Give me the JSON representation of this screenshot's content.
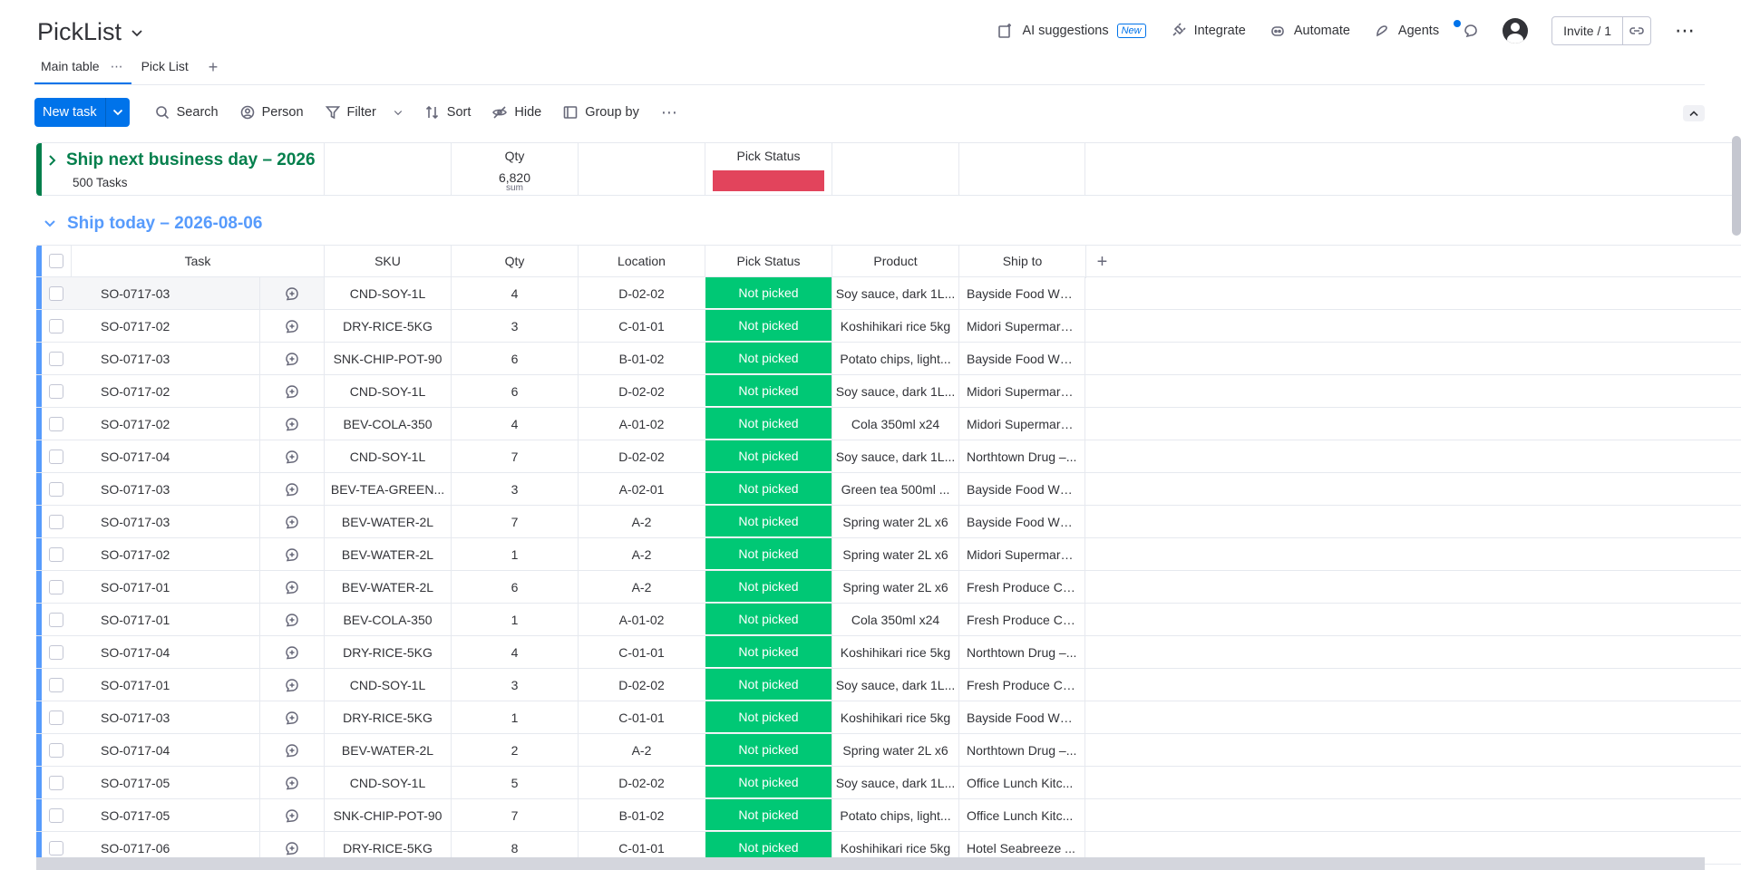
{
  "board": {
    "title": "PickList"
  },
  "top_actions": {
    "ai_suggestions": "AI suggestions",
    "ai_badge": "New",
    "integrate": "Integrate",
    "automate": "Automate",
    "agents": "Agents",
    "invite": "Invite / 1"
  },
  "tabs": [
    {
      "label": "Main table",
      "active": true
    },
    {
      "label": "Pick List",
      "active": false
    }
  ],
  "toolbar": {
    "new_task": "New task",
    "search": "Search",
    "person": "Person",
    "filter": "Filter",
    "sort": "Sort",
    "hide": "Hide",
    "group_by": "Group by"
  },
  "collapsed_group": {
    "name": "Ship next business day – 2026",
    "count": "500 Tasks",
    "qty_header": "Qty",
    "qty_value": "6,820",
    "qty_caption": "sum",
    "status_header": "Pick Status",
    "status_color": "#e2445c",
    "color": "#037f4c"
  },
  "group": {
    "name": "Ship today – 2026-08-06",
    "color": "#579bfc"
  },
  "columns": {
    "task": "Task",
    "sku": "SKU",
    "qty": "Qty",
    "location": "Location",
    "status": "Pick Status",
    "product": "Product",
    "ship_to": "Ship to"
  },
  "status_colors": {
    "Not picked": "#00c875"
  },
  "rows": [
    {
      "task": "SO-0717-03",
      "sku": "CND-SOY-1L",
      "qty": "4",
      "location": "D-02-02",
      "status": "Not picked",
      "product": "Soy sauce, dark 1L...",
      "ship_to": "Bayside Food Wh..."
    },
    {
      "task": "SO-0717-02",
      "sku": "DRY-RICE-5KG",
      "qty": "3",
      "location": "C-01-01",
      "status": "Not picked",
      "product": "Koshihikari rice 5kg",
      "ship_to": "Midori Supermark..."
    },
    {
      "task": "SO-0717-03",
      "sku": "SNK-CHIP-POT-90",
      "qty": "6",
      "location": "B-01-02",
      "status": "Not picked",
      "product": "Potato chips, light...",
      "ship_to": "Bayside Food Wh..."
    },
    {
      "task": "SO-0717-02",
      "sku": "CND-SOY-1L",
      "qty": "6",
      "location": "D-02-02",
      "status": "Not picked",
      "product": "Soy sauce, dark 1L...",
      "ship_to": "Midori Supermark..."
    },
    {
      "task": "SO-0717-02",
      "sku": "BEV-COLA-350",
      "qty": "4",
      "location": "A-01-02",
      "status": "Not picked",
      "product": "Cola 350ml x24",
      "ship_to": "Midori Supermark..."
    },
    {
      "task": "SO-0717-04",
      "sku": "CND-SOY-1L",
      "qty": "7",
      "location": "D-02-02",
      "status": "Not picked",
      "product": "Soy sauce, dark 1L...",
      "ship_to": "Northtown Drug –..."
    },
    {
      "task": "SO-0717-03",
      "sku": "BEV-TEA-GREEN...",
      "qty": "3",
      "location": "A-02-01",
      "status": "Not picked",
      "product": "Green tea 500ml ...",
      "ship_to": "Bayside Food Wh..."
    },
    {
      "task": "SO-0717-03",
      "sku": "BEV-WATER-2L",
      "qty": "7",
      "location": "A-2",
      "status": "Not picked",
      "product": "Spring water 2L x6",
      "ship_to": "Bayside Food Wh..."
    },
    {
      "task": "SO-0717-02",
      "sku": "BEV-WATER-2L",
      "qty": "1",
      "location": "A-2",
      "status": "Not picked",
      "product": "Spring water 2L x6",
      "ship_to": "Midori Supermark..."
    },
    {
      "task": "SO-0717-01",
      "sku": "BEV-WATER-2L",
      "qty": "6",
      "location": "A-2",
      "status": "Not picked",
      "product": "Spring water 2L x6",
      "ship_to": "Fresh Produce Co...."
    },
    {
      "task": "SO-0717-01",
      "sku": "BEV-COLA-350",
      "qty": "1",
      "location": "A-01-02",
      "status": "Not picked",
      "product": "Cola 350ml x24",
      "ship_to": "Fresh Produce Co...."
    },
    {
      "task": "SO-0717-04",
      "sku": "DRY-RICE-5KG",
      "qty": "4",
      "location": "C-01-01",
      "status": "Not picked",
      "product": "Koshihikari rice 5kg",
      "ship_to": "Northtown Drug –..."
    },
    {
      "task": "SO-0717-01",
      "sku": "CND-SOY-1L",
      "qty": "3",
      "location": "D-02-02",
      "status": "Not picked",
      "product": "Soy sauce, dark 1L...",
      "ship_to": "Fresh Produce Co...."
    },
    {
      "task": "SO-0717-03",
      "sku": "DRY-RICE-5KG",
      "qty": "1",
      "location": "C-01-01",
      "status": "Not picked",
      "product": "Koshihikari rice 5kg",
      "ship_to": "Bayside Food Wh..."
    },
    {
      "task": "SO-0717-04",
      "sku": "BEV-WATER-2L",
      "qty": "2",
      "location": "A-2",
      "status": "Not picked",
      "product": "Spring water 2L x6",
      "ship_to": "Northtown Drug –..."
    },
    {
      "task": "SO-0717-05",
      "sku": "CND-SOY-1L",
      "qty": "5",
      "location": "D-02-02",
      "status": "Not picked",
      "product": "Soy sauce, dark 1L...",
      "ship_to": "Office Lunch Kitc..."
    },
    {
      "task": "SO-0717-05",
      "sku": "SNK-CHIP-POT-90",
      "qty": "7",
      "location": "B-01-02",
      "status": "Not picked",
      "product": "Potato chips, light...",
      "ship_to": "Office Lunch Kitc..."
    },
    {
      "task": "SO-0717-06",
      "sku": "DRY-RICE-5KG",
      "qty": "8",
      "location": "C-01-01",
      "status": "Not picked",
      "product": "Koshihikari rice 5kg",
      "ship_to": "Hotel Seabreeze ..."
    }
  ]
}
